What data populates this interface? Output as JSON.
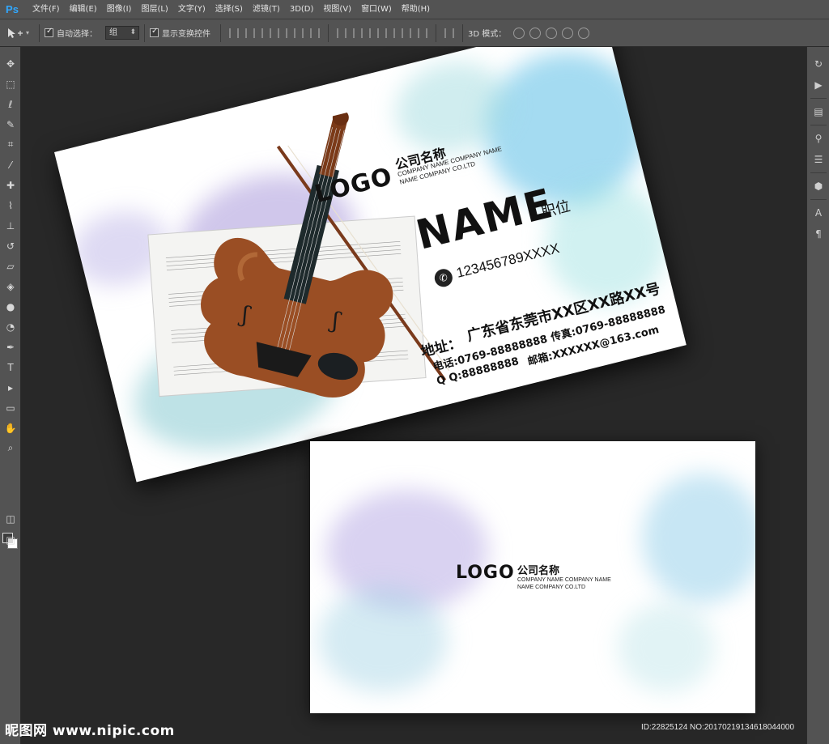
{
  "app": {
    "logo": "Ps"
  },
  "menu": [
    "文件(F)",
    "编辑(E)",
    "图像(I)",
    "图层(L)",
    "文字(Y)",
    "选择(S)",
    "滤镜(T)",
    "3D(D)",
    "视图(V)",
    "窗口(W)",
    "帮助(H)"
  ],
  "options": {
    "auto_select_label": "自动选择：",
    "auto_select_value": "组",
    "show_transform_label": "显示变换控件",
    "mode_3d_label": "3D 模式："
  },
  "front_card": {
    "logo": "LOGO",
    "company_cn": "公司名称",
    "company_en_1": "COMPANY NAME COMPANY NAME",
    "company_en_2": "NAME COMPANY CO.LTD",
    "name": "NAME",
    "title": "职位",
    "phone": "123456789XXXX",
    "address_label": "地址：",
    "address": "广东省东莞市XX区XX路XX号",
    "tel": "电话:0769-88888888",
    "fax": "传真:0769-88888888",
    "qq": "Q Q:88888888",
    "email": "邮箱:XXXXXX@163.com"
  },
  "back_card": {
    "logo": "LOGO",
    "company_cn": "公司名称",
    "company_en_1": "COMPANY NAME COMPANY NAME",
    "company_en_2": "NAME COMPANY CO.LTD"
  },
  "watermark": {
    "left": "昵图网 www.nipic.com",
    "right": "ID:22825124 NO:20170219134618044000"
  }
}
